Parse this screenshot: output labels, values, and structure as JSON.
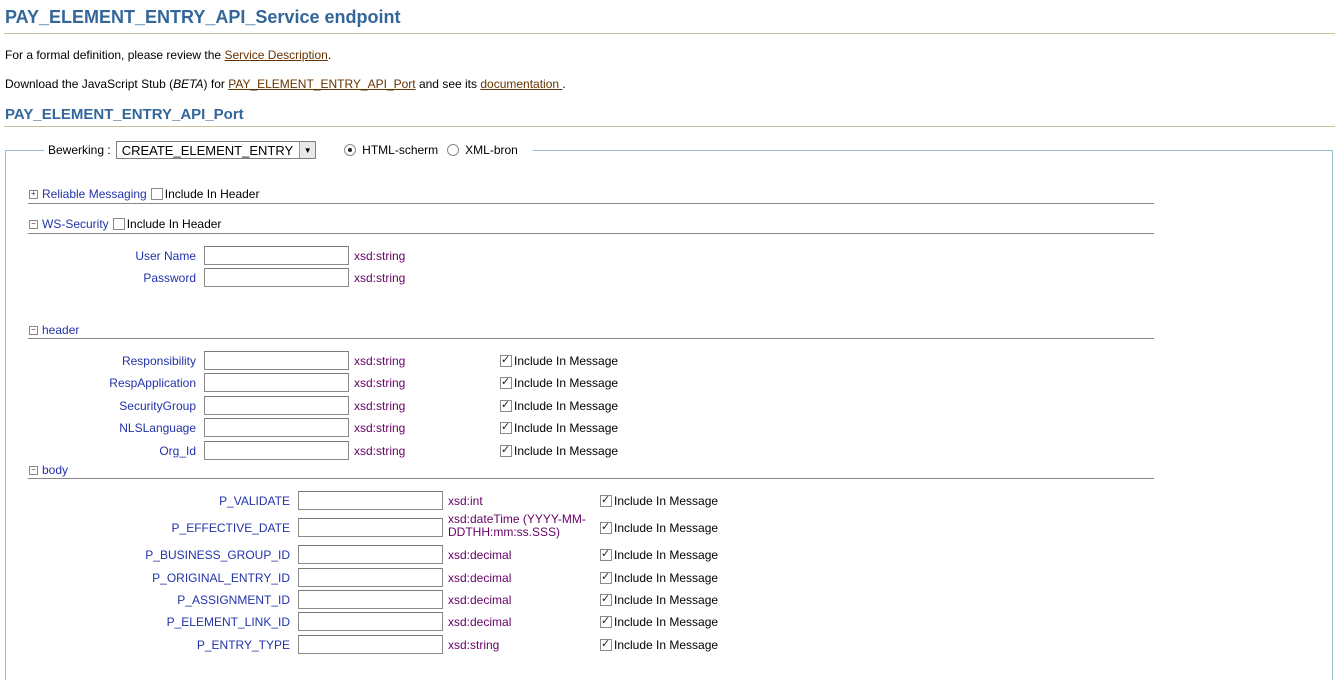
{
  "page_title": "PAY_ELEMENT_ENTRY_API_Service endpoint",
  "intro": {
    "line1_prefix": "For a formal definition, please review the ",
    "line1_link": "Service Description",
    "line1_suffix": ".",
    "line2_prefix": "Download the JavaScript Stub (",
    "line2_italic": "BETA",
    "line2_mid": ") for ",
    "line2_link1": "PAY_ELEMENT_ENTRY_API_Port",
    "line2_mid2": " and see its ",
    "line2_link2": "documentation ",
    "line2_suffix": "."
  },
  "port_title": "PAY_ELEMENT_ENTRY_API_Port",
  "operation": {
    "label": "Bewerking :",
    "selected": "CREATE_ELEMENT_ENTRY",
    "view_html": "HTML-scherm",
    "view_xml": "XML-bron"
  },
  "sections": {
    "reliable": {
      "label": "Reliable Messaging",
      "include": "Include In Header"
    },
    "wssecurity": {
      "label": "WS-Security",
      "include": "Include In Header"
    },
    "header": {
      "label": "header"
    },
    "body": {
      "label": "body"
    }
  },
  "ws_fields": [
    {
      "label": "User Name",
      "value": "",
      "type": "xsd:string"
    },
    {
      "label": "Password",
      "value": "",
      "type": "xsd:string"
    }
  ],
  "header_fields": [
    {
      "label": "Responsibility",
      "value": "",
      "type": "xsd:string",
      "include": "Include In Message"
    },
    {
      "label": "RespApplication",
      "value": "",
      "type": "xsd:string",
      "include": "Include In Message"
    },
    {
      "label": "SecurityGroup",
      "value": "",
      "type": "xsd:string",
      "include": "Include In Message"
    },
    {
      "label": "NLSLanguage",
      "value": "",
      "type": "xsd:string",
      "include": "Include In Message"
    },
    {
      "label": "Org_Id",
      "value": "",
      "type": "xsd:string",
      "include": "Include In Message"
    }
  ],
  "body_fields": [
    {
      "label": "P_VALIDATE",
      "value": "",
      "type": "xsd:int",
      "include": "Include In Message"
    },
    {
      "label": "P_EFFECTIVE_DATE",
      "value": "",
      "type": "xsd:dateTime (YYYY-MM-DDTHH:mm:ss.SSS)",
      "include": "Include In Message"
    },
    {
      "label": "P_BUSINESS_GROUP_ID",
      "value": "",
      "type": "xsd:decimal",
      "include": "Include In Message"
    },
    {
      "label": "P_ORIGINAL_ENTRY_ID",
      "value": "",
      "type": "xsd:decimal",
      "include": "Include In Message"
    },
    {
      "label": "P_ASSIGNMENT_ID",
      "value": "",
      "type": "xsd:decimal",
      "include": "Include In Message"
    },
    {
      "label": "P_ELEMENT_LINK_ID",
      "value": "",
      "type": "xsd:decimal",
      "include": "Include In Message"
    },
    {
      "label": "P_ENTRY_TYPE",
      "value": "",
      "type": "xsd:string",
      "include": "Include In Message"
    }
  ]
}
